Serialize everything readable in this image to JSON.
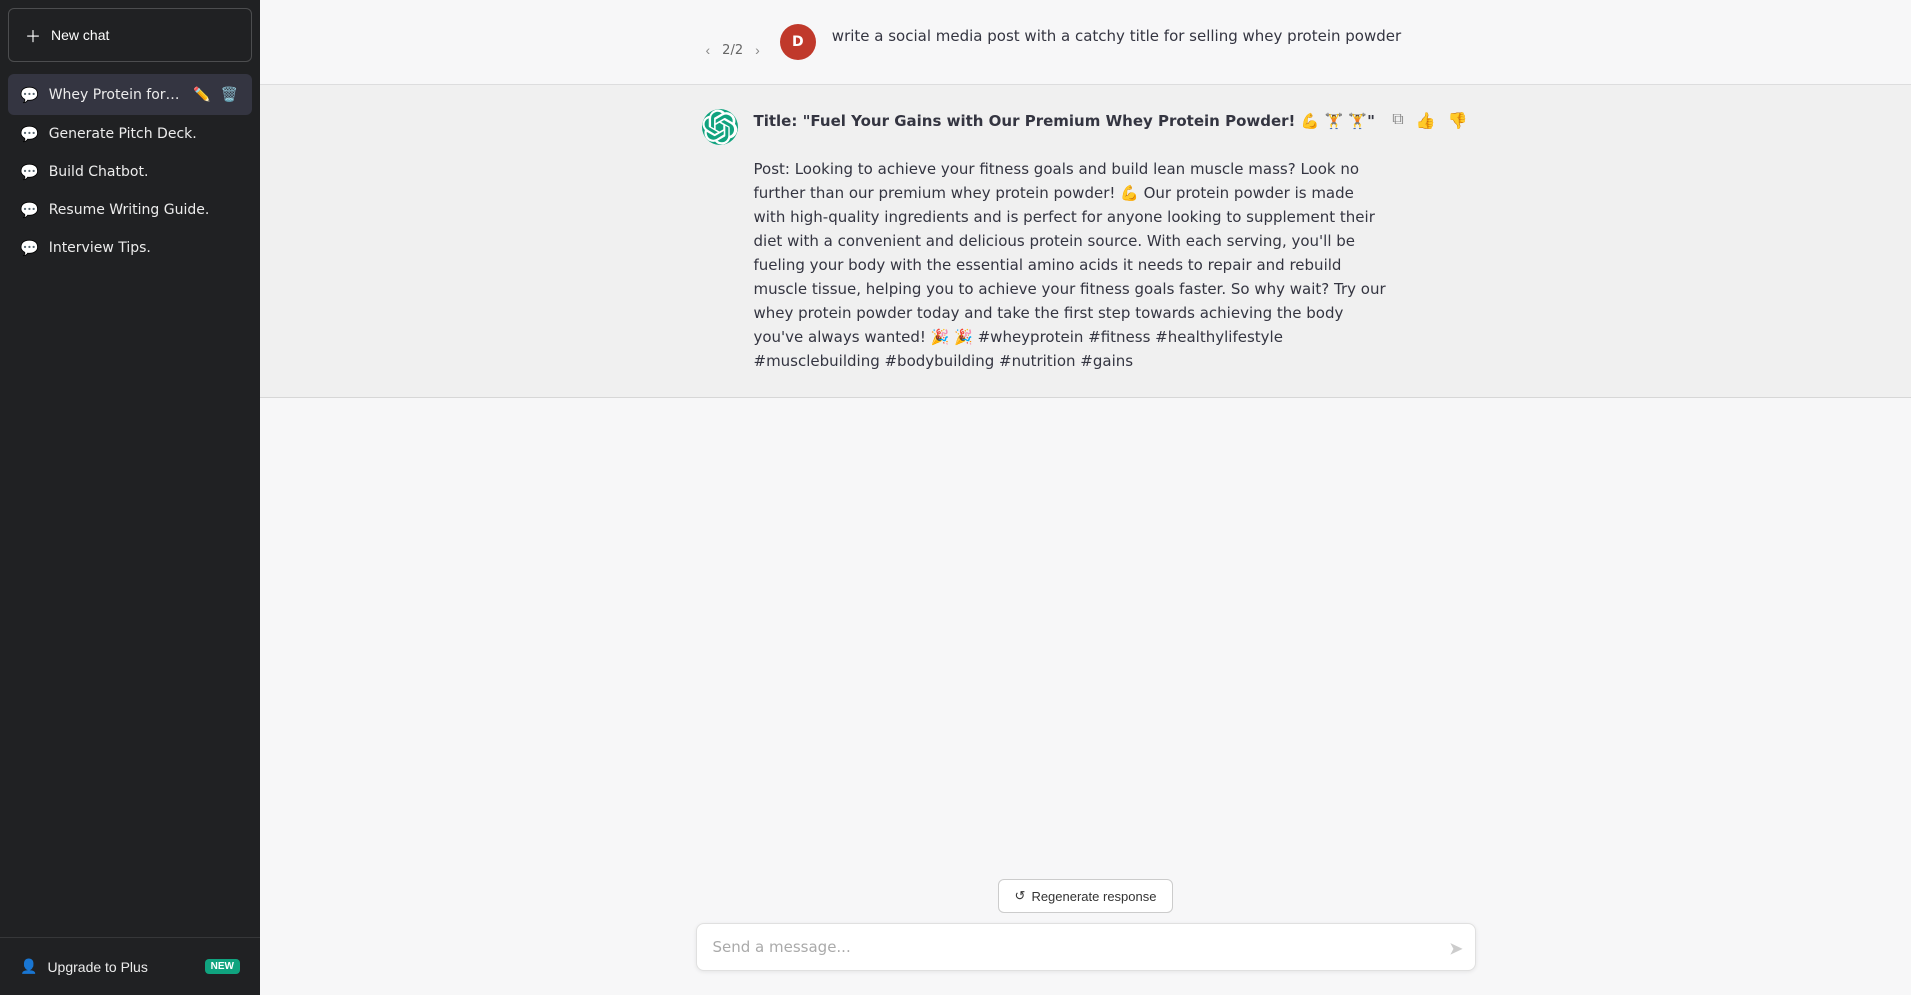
{
  "sidebar": {
    "new_chat_label": "New chat",
    "items": [
      {
        "id": "whey-protein",
        "label": "Whey Protein for Gains.",
        "active": true
      },
      {
        "id": "pitch-deck",
        "label": "Generate Pitch Deck.",
        "active": false
      },
      {
        "id": "build-chatbot",
        "label": "Build Chatbot.",
        "active": false
      },
      {
        "id": "resume-writing",
        "label": "Resume Writing Guide.",
        "active": false
      },
      {
        "id": "interview-tips",
        "label": "Interview Tips.",
        "active": false
      }
    ],
    "footer": {
      "upgrade_label": "Upgrade to Plus",
      "new_badge": "NEW",
      "user_icon": "👤"
    }
  },
  "chat": {
    "pagination": {
      "current": 2,
      "total": 2
    },
    "user_message": "write a social media post with a catchy title for selling whey protein powder",
    "user_avatar_initial": "D",
    "ai_response_title": "Title: \"Fuel Your Gains with Our Premium Whey Protein Powder! 💪 🏋 🏋\"",
    "ai_response_body": "Post: Looking to achieve your fitness goals and build lean muscle mass? Look no further than our premium whey protein powder! 💪 Our protein powder is made with high-quality ingredients and is perfect for anyone looking to supplement their diet with a convenient and delicious protein source. With each serving, you'll be fueling your body with the essential amino acids it needs to repair and rebuild muscle tissue, helping you to achieve your fitness goals faster. So why wait? Try our whey protein powder today and take the first step towards achieving the body you've always wanted! 🎉 🎉 #wheyprotein #fitness #healthylifestyle #musclebuilding #bodybuilding #nutrition #gains"
  },
  "input": {
    "placeholder": "Send a message...",
    "regenerate_label": "Regenerate response"
  }
}
